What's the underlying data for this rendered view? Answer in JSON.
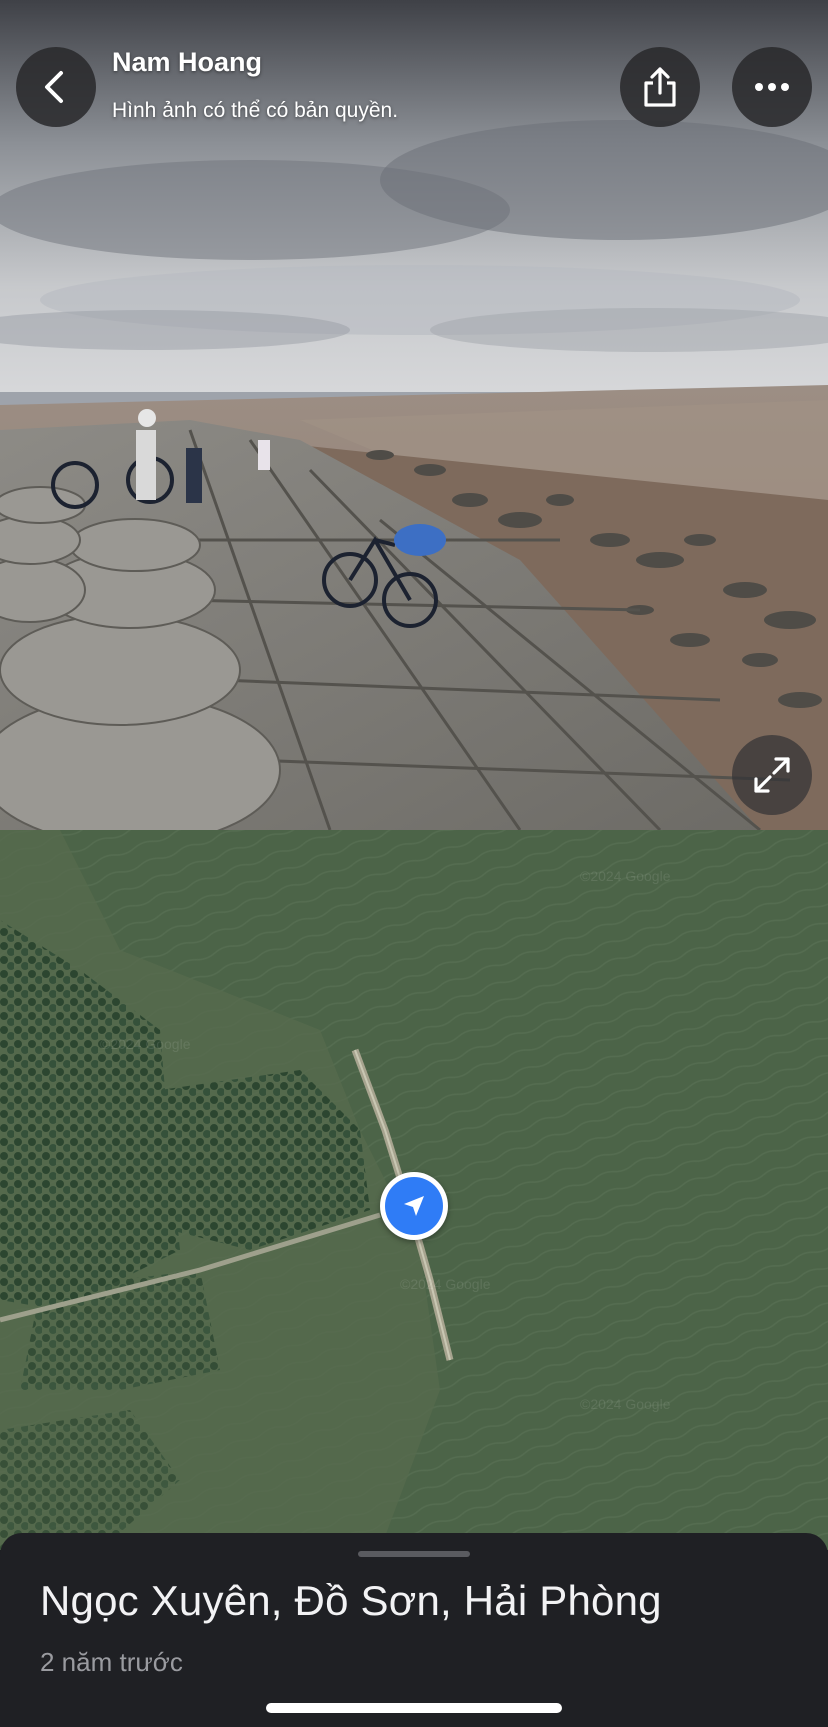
{
  "header": {
    "author": "Nam Hoang",
    "copyright_note": "Hình ảnh có thể có bản quyền.",
    "back_icon": "chevron-left-icon",
    "share_icon": "share-icon",
    "more_icon": "more-horizontal-icon",
    "expand_icon": "expand-icon"
  },
  "map": {
    "watermark_text": "©2024 Google",
    "marker_icon": "navigation-arrow-icon",
    "marker_color": "#2f7cf6"
  },
  "sheet": {
    "place_title": "Ngọc Xuyên, Đồ Sơn, Hải Phòng",
    "time_ago": "2 năm trước"
  }
}
